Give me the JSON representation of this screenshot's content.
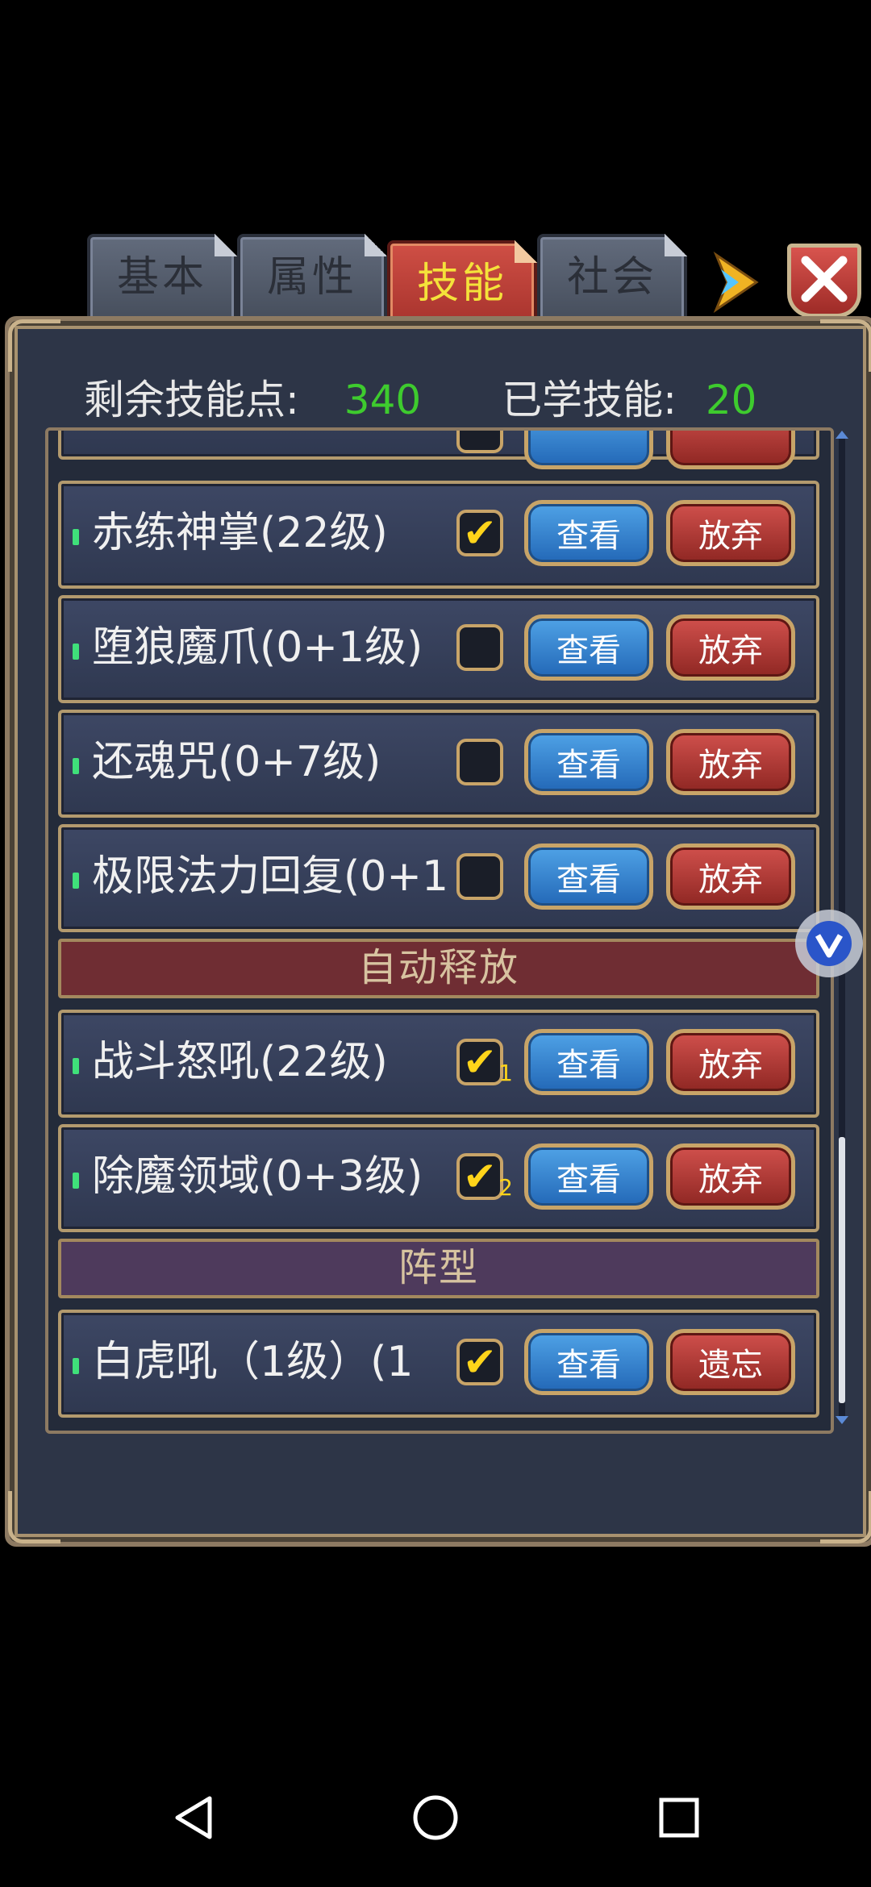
{
  "tabs": [
    {
      "label": "基本",
      "active": false
    },
    {
      "label": "属性",
      "active": false
    },
    {
      "label": "技能",
      "active": true
    },
    {
      "label": "社会",
      "active": false
    }
  ],
  "summary": {
    "remaining_label": "剩余技能点:",
    "remaining_value": "340",
    "learned_label": "已学技能:",
    "learned_value": "20"
  },
  "skills_top": [
    {
      "name": "赤练神掌(22级)",
      "checked": true,
      "view": "查看",
      "action": "放弃"
    },
    {
      "name": "堕狼魔爪(0+1级)",
      "checked": false,
      "view": "查看",
      "action": "放弃"
    },
    {
      "name": "还魂咒(0+7级)",
      "checked": false,
      "view": "查看",
      "action": "放弃"
    },
    {
      "name": "极限法力回复(0+1",
      "checked": false,
      "view": "查看",
      "action": "放弃"
    }
  ],
  "section_auto": "自动释放",
  "skills_auto": [
    {
      "name": "战斗怒吼(22级)",
      "checked": true,
      "index": "1",
      "view": "查看",
      "action": "放弃"
    },
    {
      "name": "除魔领域(0+3级)",
      "checked": true,
      "index": "2",
      "view": "查看",
      "action": "放弃"
    }
  ],
  "section_formation": "阵型",
  "skills_formation": [
    {
      "name": "白虎吼（1级）(1",
      "checked": true,
      "view": "查看",
      "action": "遗忘"
    }
  ],
  "colors": {
    "accent_green": "#3ecb2e",
    "active_tab": "#c0403a",
    "active_tab_text": "#f4e23a"
  },
  "icons": {
    "next": "arrow-right-icon",
    "close": "close-icon",
    "assistant": "v-badge-icon"
  }
}
